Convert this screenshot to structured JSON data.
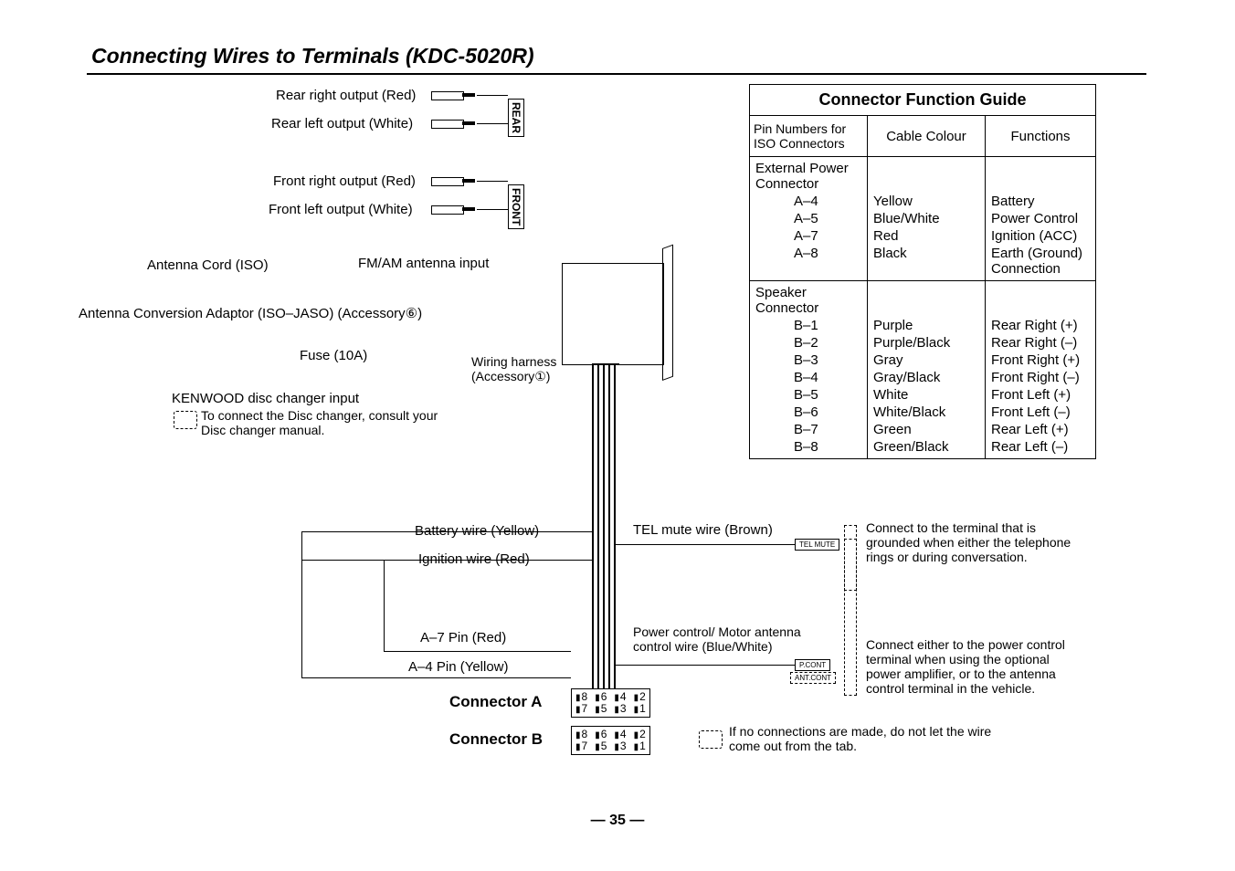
{
  "title": "Connecting Wires to Terminals (KDC-5020R)",
  "page_number": "— 35 —",
  "labels": {
    "rear_right_out": "Rear right output (Red)",
    "rear_left_out": "Rear left output (White)",
    "front_right_out": "Front right output (Red)",
    "front_left_out": "Front left output (White)",
    "rear_tag": "REAR",
    "front_tag": "FRONT",
    "antenna_cord": "Antenna Cord (ISO)",
    "fm_am_input": "FM/AM antenna input",
    "antenna_adaptor": "Antenna Conversion Adaptor (ISO–JASO) (Accessory⑥)",
    "fuse": "Fuse (10A)",
    "wiring_harness": "Wiring harness\n(Accessory①)",
    "disc_changer_input": "KENWOOD disc changer input",
    "disc_changer_note": "To connect the Disc changer, consult your\nDisc changer manual.",
    "battery_wire": "Battery wire (Yellow)",
    "ignition_wire": "Ignition wire (Red)",
    "a7_pin": "A–7 Pin (Red)",
    "a4_pin": "A–4 Pin (Yellow)",
    "connector_a": "Connector A",
    "connector_b": "Connector B",
    "tel_mute_wire": "TEL mute wire (Brown)",
    "tel_mute_tag": "TEL MUTE",
    "tel_mute_note": "Connect to the terminal that is\ngrounded when either the telephone\nrings or during conversation.",
    "power_control_wire": "Power control/ Motor antenna\ncontrol wire (Blue/White)",
    "pcont_tag": "P.CONT",
    "antcont_tag": "ANT.CONT",
    "power_control_note": "Connect either to the power control\nterminal when using the optional\npower amplifier, or to the antenna\ncontrol terminal in the vehicle.",
    "no_conn_note": "If no connections are made, do not let the wire\ncome out from the tab."
  },
  "guide": {
    "title": "Connector Function Guide",
    "headers": [
      "Pin Numbers for\nISO Connectors",
      "Cable Colour",
      "Functions"
    ],
    "sections": [
      {
        "name": "External Power\nConnector",
        "rows": [
          {
            "pin": "A–4",
            "colour": "Yellow",
            "func": "Battery"
          },
          {
            "pin": "A–5",
            "colour": "Blue/White",
            "func": "Power Control"
          },
          {
            "pin": "A–7",
            "colour": "Red",
            "func": "Ignition (ACC)"
          },
          {
            "pin": "A–8",
            "colour": "Black",
            "func": "Earth (Ground)\nConnection"
          }
        ]
      },
      {
        "name": "Speaker\nConnector",
        "rows": [
          {
            "pin": "B–1",
            "colour": "Purple",
            "func": "Rear Right (+)"
          },
          {
            "pin": "B–2",
            "colour": "Purple/Black",
            "func": "Rear Right (–)"
          },
          {
            "pin": "B–3",
            "colour": "Gray",
            "func": "Front Right (+)"
          },
          {
            "pin": "B–4",
            "colour": "Gray/Black",
            "func": "Front Right (–)"
          },
          {
            "pin": "B–5",
            "colour": "White",
            "func": "Front Left (+)"
          },
          {
            "pin": "B–6",
            "colour": "White/Black",
            "func": "Front Left (–)"
          },
          {
            "pin": "B–7",
            "colour": "Green",
            "func": "Rear Left (+)"
          },
          {
            "pin": "B–8",
            "colour": "Green/Black",
            "func": "Rear Left (–)"
          }
        ]
      }
    ]
  },
  "connector_pins": {
    "top": [
      "8",
      "6",
      "4",
      "2"
    ],
    "bottom": [
      "7",
      "5",
      "3",
      "1"
    ]
  }
}
